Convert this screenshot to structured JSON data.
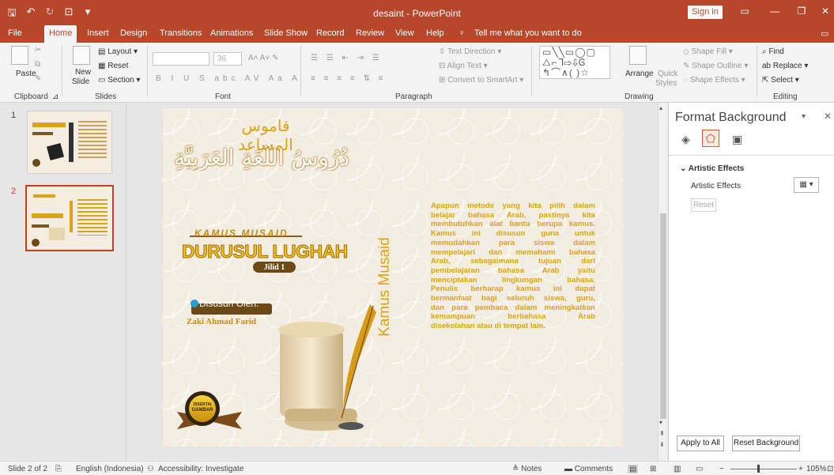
{
  "app": {
    "title": "desaint  -  PowerPoint",
    "signin": "Sign in"
  },
  "tabs": [
    {
      "label": "File"
    },
    {
      "label": "Home"
    },
    {
      "label": "Insert"
    },
    {
      "label": "Design"
    },
    {
      "label": "Transitions"
    },
    {
      "label": "Animations"
    },
    {
      "label": "Slide Show"
    },
    {
      "label": "Record"
    },
    {
      "label": "Review"
    },
    {
      "label": "View"
    },
    {
      "label": "Help"
    }
  ],
  "tell_me": "Tell me what you want to do",
  "ribbon": {
    "clipboard": {
      "label": "Clipboard",
      "paste": "Paste"
    },
    "slides": {
      "label": "Slides",
      "new_slide": "New",
      "new_slide2": "Slide",
      "layout": "Layout",
      "reset": "Reset",
      "section": "Section"
    },
    "font": {
      "label": "Font",
      "size": "36"
    },
    "paragraph": {
      "label": "Paragraph",
      "text_direction": "Text Direction",
      "align_text": "Align Text",
      "convert_smartart": "Convert to SmartArt"
    },
    "drawing": {
      "label": "Drawing",
      "arrange": "Arrange",
      "quick_styles": "Quick",
      "quick_styles2": "Styles",
      "shape_fill": "Shape Fill",
      "shape_outline": "Shape Outline",
      "shape_effects": "Shape Effects"
    },
    "editing": {
      "label": "Editing",
      "find": "Find",
      "replace": "Replace",
      "select": "Select"
    }
  },
  "thumbnails": [
    {
      "num": "1"
    },
    {
      "num": "2"
    }
  ],
  "slide": {
    "arabic_title": "قاموس المساعد",
    "arabic_calligraphy": "دُرُوسُ اللُّغَةِ العَرَبِيَّةِ",
    "kamus_small": "KAMUS MUSAID",
    "main_title": "DURUSUL LUGHAH",
    "jilid": "Jilid 1",
    "disusun": "Disusun Oleh:",
    "author": "Zaki Ahmad Farid",
    "vertical_text": "Kamus Musaid",
    "badge_top": "DISERTAI",
    "badge_bottom": "GAMBAR",
    "paragraph_lines": [
      "Apapun metode yang kita pilih dalam",
      "belajar bahasa Arab, pastinya kita",
      "membutuhkan alat bantu berupa kamus.",
      "Kamus ini disusun guna untuk",
      "memudahkan para siswa dalam",
      "mempelajari dan memahami bahasa",
      "Arab, sebagaimana tujuan dari",
      "pembelajaran bahasa Arab yaitu",
      "menciptakan lingkungan bahasa.",
      "Penulis berharap kamus ini dapat",
      "bermanfaat bagi seluruh siswa, guru,",
      "dan para pembaca dalam meningkatkan",
      "kemampuan berbahasa Arab",
      "disekolahan atau di tempat lain."
    ]
  },
  "format_panel": {
    "title": "Format Background",
    "section": "Artistic Effects",
    "row_label": "Artistic Effects",
    "reset": "Reset",
    "apply_all": "Apply to All",
    "reset_bg": "Reset Background"
  },
  "status": {
    "slide": "Slide 2 of 2",
    "language": "English (Indonesia)",
    "accessibility": "Accessibility: Investigate",
    "notes": "Notes",
    "comments": "Comments",
    "zoom": "105%"
  },
  "colors": {
    "accent": "#b7472a",
    "gold": "#d9a514",
    "brown": "#8a5a1e"
  },
  "icons": [
    "save-icon",
    "undo-icon",
    "redo-icon",
    "present-icon",
    "search-icon",
    "lightbulb-icon",
    "fill-icon",
    "effects-icon",
    "picture-icon"
  ]
}
